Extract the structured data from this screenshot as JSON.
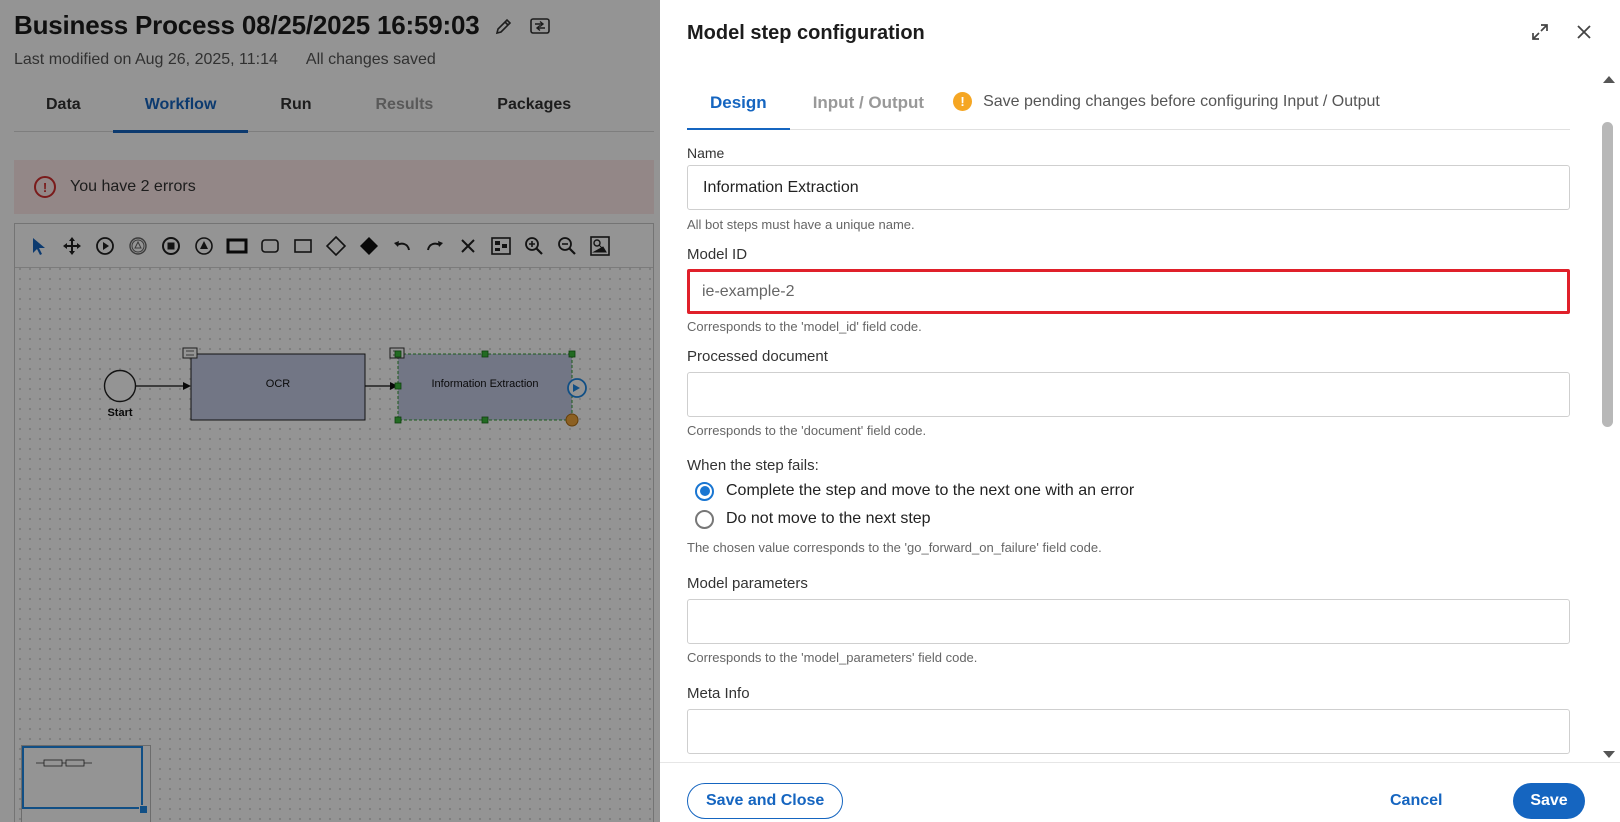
{
  "app": {
    "title": "Business Process 08/25/2025 16:59:03",
    "last_modified": "Last modified on Aug 26, 2025, 11:14",
    "save_status": "All changes saved",
    "tabs": [
      {
        "label": "Data",
        "state": "normal"
      },
      {
        "label": "Workflow",
        "state": "active"
      },
      {
        "label": "Run",
        "state": "normal"
      },
      {
        "label": "Results",
        "state": "disabled"
      },
      {
        "label": "Packages",
        "state": "normal"
      }
    ],
    "error_banner": "You have 2 errors",
    "toolbar_icons": [
      "pointer-icon",
      "move-icon",
      "start-event-icon",
      "intermediate-event-icon",
      "end-event-icon",
      "escalation-event-icon",
      "task-icon",
      "rounded-task-icon",
      "subprocess-icon",
      "gateway-icon",
      "exclusive-gateway-icon",
      "undo-icon",
      "redo-icon",
      "delete-icon",
      "layout-icon",
      "zoom-in-icon",
      "zoom-out-icon",
      "fit-icon"
    ],
    "diagram": {
      "start_label": "Start",
      "node_1": "OCR",
      "node_2": "Information Extraction"
    }
  },
  "panel": {
    "title": "Model step configuration",
    "tabs": {
      "design": "Design",
      "input_output": "Input / Output"
    },
    "pending_message": "Save pending changes before configuring Input / Output",
    "fields": {
      "name": {
        "label": "Name",
        "value": "Information Extraction",
        "hint": "All bot steps must have a unique name."
      },
      "model_id": {
        "label": "Model ID",
        "value": "ie-example-2",
        "hint": "Corresponds to the 'model_id' field code."
      },
      "processed_document": {
        "label": "Processed document",
        "value": "",
        "hint": "Corresponds to the 'document' field code."
      },
      "failure": {
        "label": "When the step fails:",
        "option_1": "Complete the step and move to the next one with an error",
        "option_2": "Do not move to the next step",
        "selected": "option_1",
        "hint": "The chosen value corresponds to the 'go_forward_on_failure' field code."
      },
      "model_parameters": {
        "label": "Model parameters",
        "value": "",
        "hint": "Corresponds to the 'model_parameters' field code."
      },
      "meta_info": {
        "label": "Meta Info",
        "value": ""
      }
    },
    "footer": {
      "save_and_close": "Save and Close",
      "cancel": "Cancel",
      "save": "Save"
    }
  },
  "colors": {
    "accent": "#1565c0",
    "error": "#e0202a",
    "warning": "#f5a623",
    "node_fill": "#c5cbe6",
    "selection": "#2e9e2e"
  }
}
